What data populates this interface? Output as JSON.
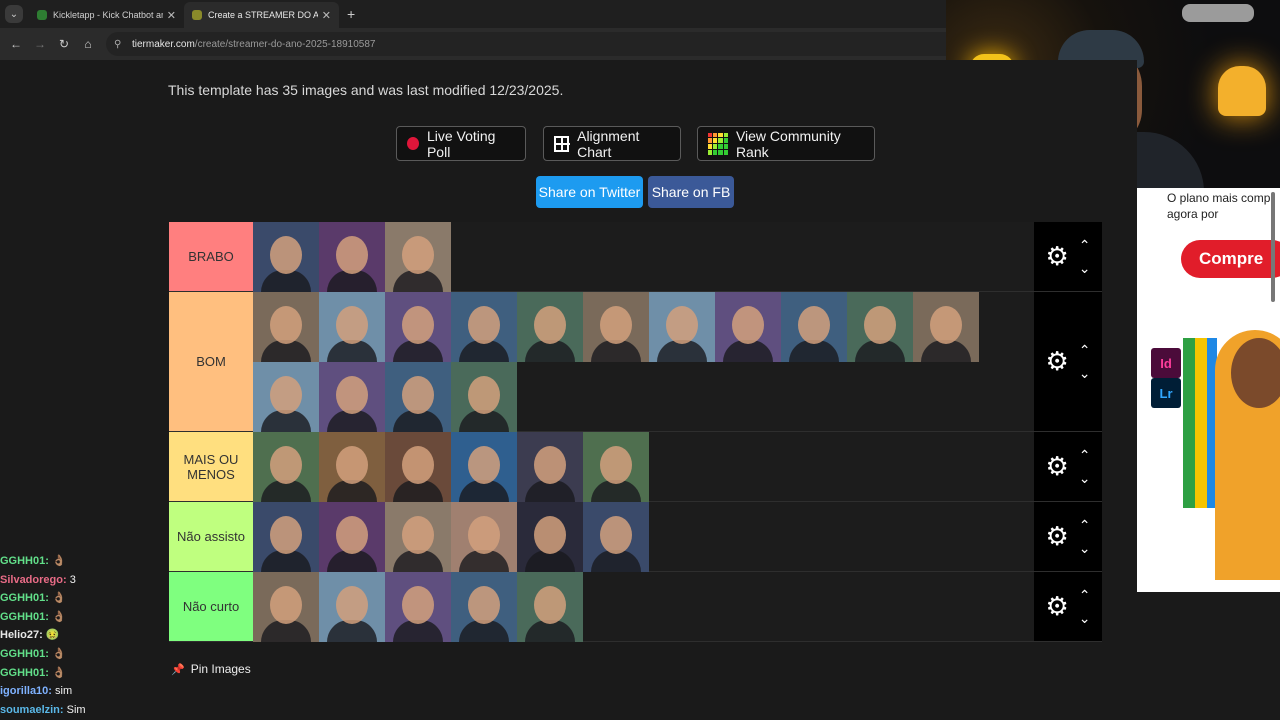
{
  "browser": {
    "tabs": [
      {
        "title": "Kickletapp - Kick Chatbot and (",
        "favicon_color": "#2e7d32"
      },
      {
        "title": "Create a STREAMER DO ANO (",
        "favicon_color": "#8a8a2a"
      }
    ],
    "tab_menu_icon": "chevron-down-icon",
    "new_tab": "+",
    "close": "✕",
    "url_host": "tiermaker.com",
    "url_path": "/create/streamer-do-ano-2025-18910587"
  },
  "page": {
    "template_info": "This template has 35 images and was last modified 12/23/2025.",
    "buttons": {
      "live_voting": "Live Voting Poll",
      "alignment": "Alignment Chart",
      "community_rank": "View Community Rank"
    },
    "share": {
      "twitter": "Share on Twitter",
      "fb": "Share on FB",
      "twitter_color": "#1d9bf0",
      "fb_color": "#3b5998"
    },
    "pin_images": "Pin Images"
  },
  "tiers": [
    {
      "label": "BRABO",
      "color": "#ff7f7f",
      "count": 3
    },
    {
      "label": "BOM",
      "color": "#ffbf7f",
      "count": 15
    },
    {
      "label": "MAIS OU MENOS",
      "color": "#ffdf7f",
      "count": 6
    },
    {
      "label": "Não assisto",
      "color": "#bfff7f",
      "count": 6
    },
    {
      "label": "Não curto",
      "color": "#7fff7f",
      "count": 5
    }
  ],
  "ad": {
    "headline": "O plano mais comp agora por",
    "cta": "Compre",
    "app_icons": [
      "Id",
      "Lr"
    ]
  },
  "chat": [
    {
      "user": "GGHH01:",
      "msg": "👌🏽",
      "color": "#62e08a"
    },
    {
      "user": "Silvadorego:",
      "msg": "3",
      "color": "#e86b86"
    },
    {
      "user": "GGHH01:",
      "msg": "👌🏽",
      "color": "#62e08a"
    },
    {
      "user": "GGHH01:",
      "msg": "👌🏽",
      "color": "#62e08a"
    },
    {
      "user": "Helio27:",
      "msg": "🤢",
      "color": "#e8e8e8"
    },
    {
      "user": "GGHH01:",
      "msg": "👌🏽",
      "color": "#62e08a"
    },
    {
      "user": "GGHH01:",
      "msg": "👌🏽",
      "color": "#62e08a"
    },
    {
      "user": "igorilla10:",
      "msg": "sim",
      "color": "#7fb2ff"
    },
    {
      "user": "soumaelzin:",
      "msg": "Sim",
      "color": "#5ab8e8"
    }
  ]
}
